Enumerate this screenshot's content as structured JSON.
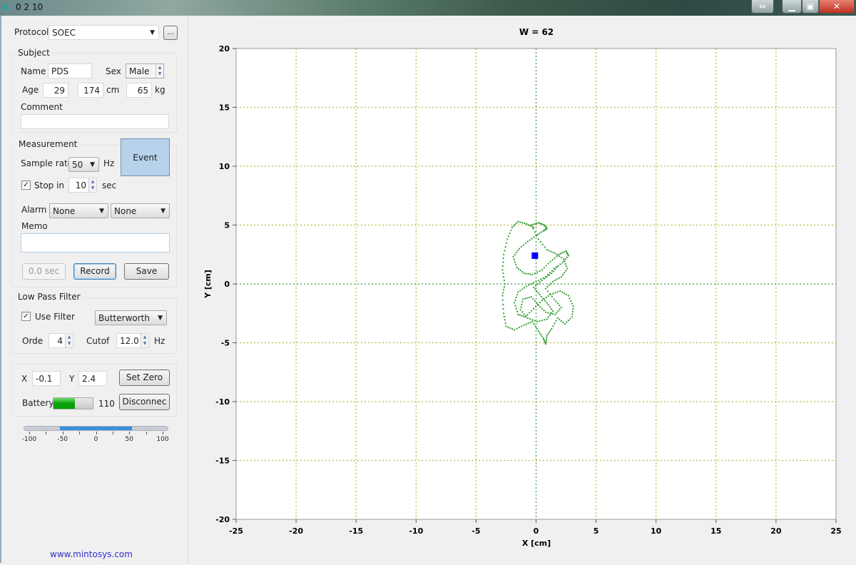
{
  "window": {
    "title": "0 2 10",
    "app_icon": "mintosys-logo-icon",
    "buttons": [
      "resize-arrows-icon",
      "minimize-icon",
      "maximize-icon",
      "close-icon"
    ]
  },
  "protocol": {
    "label": "Protocol",
    "value": "SOEC",
    "browse_label": "..."
  },
  "subject": {
    "group_label": "Subject",
    "name_label": "Name",
    "name_value": "PDS",
    "sex_label": "Sex",
    "sex_value": "Male",
    "age_label": "Age",
    "age_value": "29",
    "height_value": "174",
    "height_unit": "cm",
    "weight_value": "65",
    "weight_unit": "kg",
    "comment_label": "Comment",
    "comment_value": ""
  },
  "measurement": {
    "group_label": "Measurement",
    "sample_rate_label": "Sample rate",
    "sample_rate_value": "50",
    "sample_rate_unit": "Hz",
    "stop_in_label": "Stop in",
    "stop_in_checked": true,
    "stop_in_value": "10",
    "stop_in_unit": "sec",
    "event_label": "Event",
    "alarm_label": "Alarm",
    "alarm_value_1": "None",
    "alarm_value_2": "None",
    "memo_label": "Memo",
    "memo_value": "",
    "timer_label": "0.0 sec",
    "record_label": "Record",
    "save_label": "Save"
  },
  "filter": {
    "group_label": "Low Pass Filter",
    "use_filter_label": "Use Filter",
    "use_filter_checked": true,
    "type_value": "Butterworth",
    "order_label": "Orde",
    "order_value": "4",
    "cutoff_label": "Cutof",
    "cutoff_value": "12.0",
    "cutoff_unit": "Hz"
  },
  "position": {
    "x_label": "X",
    "x_value": "-0.1",
    "y_label": "Y",
    "y_value": "2.4",
    "set_zero_label": "Set Zero",
    "battery_label": "Battery",
    "battery_value": "110",
    "battery_level": 0.55,
    "disconnect_label": "Disconnec"
  },
  "range_slider": {
    "min": -100,
    "max": 100,
    "low": -50,
    "high": 50,
    "tick_labels": [
      "-100",
      "-50",
      "0",
      "50",
      "100"
    ]
  },
  "footer_link": "www.mintosys.com",
  "chart_data": {
    "type": "scatter",
    "title": "W = 62",
    "xlabel": "X [cm]",
    "ylabel": "Y [cm]",
    "xlim": [
      -25,
      25
    ],
    "ylim": [
      -20,
      20
    ],
    "x_ticks": [
      -25,
      -20,
      -15,
      -10,
      -5,
      0,
      5,
      10,
      15,
      20,
      25
    ],
    "y_ticks": [
      -20,
      -15,
      -10,
      -5,
      0,
      5,
      10,
      15,
      20
    ],
    "grid": true,
    "grid_color": "#b8b840",
    "trace_color": "#2a9a2a",
    "marker_color": "#0000ff",
    "current_point": [
      -0.1,
      2.4
    ],
    "trace_points": [
      [
        -0.2,
        4.8
      ],
      [
        -0.8,
        5.1
      ],
      [
        -1.5,
        5.3
      ],
      [
        -2.0,
        4.8
      ],
      [
        -2.4,
        3.8
      ],
      [
        -2.7,
        2.5
      ],
      [
        -2.8,
        1.2
      ],
      [
        -2.6,
        0.0
      ],
      [
        -2.8,
        -1.0
      ],
      [
        -2.7,
        -2.5
      ],
      [
        -2.5,
        -3.6
      ],
      [
        -1.8,
        -3.9
      ],
      [
        -1.0,
        -3.5
      ],
      [
        -0.3,
        -3.2
      ],
      [
        0.2,
        -4.0
      ],
      [
        0.6,
        -4.6
      ],
      [
        0.8,
        -5.1
      ],
      [
        0.9,
        -4.4
      ],
      [
        1.3,
        -3.8
      ],
      [
        1.8,
        -2.9
      ],
      [
        2.4,
        -3.4
      ],
      [
        3.0,
        -2.8
      ],
      [
        3.1,
        -1.9
      ],
      [
        2.7,
        -1.0
      ],
      [
        2.0,
        -0.6
      ],
      [
        1.2,
        -0.9
      ],
      [
        0.5,
        -1.4
      ],
      [
        -0.2,
        -2.1
      ],
      [
        -0.9,
        -2.8
      ],
      [
        -1.5,
        -2.6
      ],
      [
        -1.8,
        -1.6
      ],
      [
        -1.5,
        -0.7
      ],
      [
        -0.8,
        -0.2
      ],
      [
        0.0,
        0.2
      ],
      [
        0.8,
        0.6
      ],
      [
        1.5,
        1.3
      ],
      [
        2.2,
        1.8
      ],
      [
        2.7,
        2.4
      ],
      [
        2.5,
        2.8
      ],
      [
        1.9,
        2.5
      ],
      [
        1.2,
        1.9
      ],
      [
        0.5,
        1.2
      ],
      [
        -0.3,
        0.8
      ],
      [
        -1.0,
        0.9
      ],
      [
        -1.6,
        1.4
      ],
      [
        -1.9,
        2.3
      ],
      [
        -1.4,
        3.0
      ],
      [
        -0.7,
        3.6
      ],
      [
        0.0,
        4.1
      ],
      [
        0.6,
        4.5
      ],
      [
        0.9,
        4.7
      ],
      [
        0.7,
        5.0
      ],
      [
        0.2,
        5.2
      ],
      [
        -0.4,
        5.0
      ],
      [
        0.2,
        3.8
      ],
      [
        0.9,
        2.9
      ],
      [
        1.6,
        2.6
      ],
      [
        2.3,
        2.1
      ],
      [
        2.6,
        1.3
      ],
      [
        2.1,
        0.6
      ],
      [
        1.4,
        0.2
      ],
      [
        0.8,
        -0.4
      ],
      [
        1.5,
        -1.3
      ],
      [
        2.1,
        -2.0
      ],
      [
        1.6,
        -2.6
      ],
      [
        0.8,
        -2.4
      ],
      [
        0.2,
        -1.8
      ],
      [
        -0.4,
        -1.1
      ],
      [
        -1.1,
        -1.3
      ],
      [
        -1.3,
        -2.2
      ],
      [
        -0.7,
        -2.9
      ],
      [
        0.1,
        -3.2
      ],
      [
        0.9,
        -3.0
      ],
      [
        1.4,
        -2.3
      ],
      [
        0.9,
        -1.6
      ],
      [
        0.3,
        -0.9
      ],
      [
        -0.2,
        -0.3
      ],
      [
        0.5,
        0.3
      ],
      [
        1.3,
        0.9
      ],
      [
        1.9,
        1.6
      ]
    ]
  }
}
